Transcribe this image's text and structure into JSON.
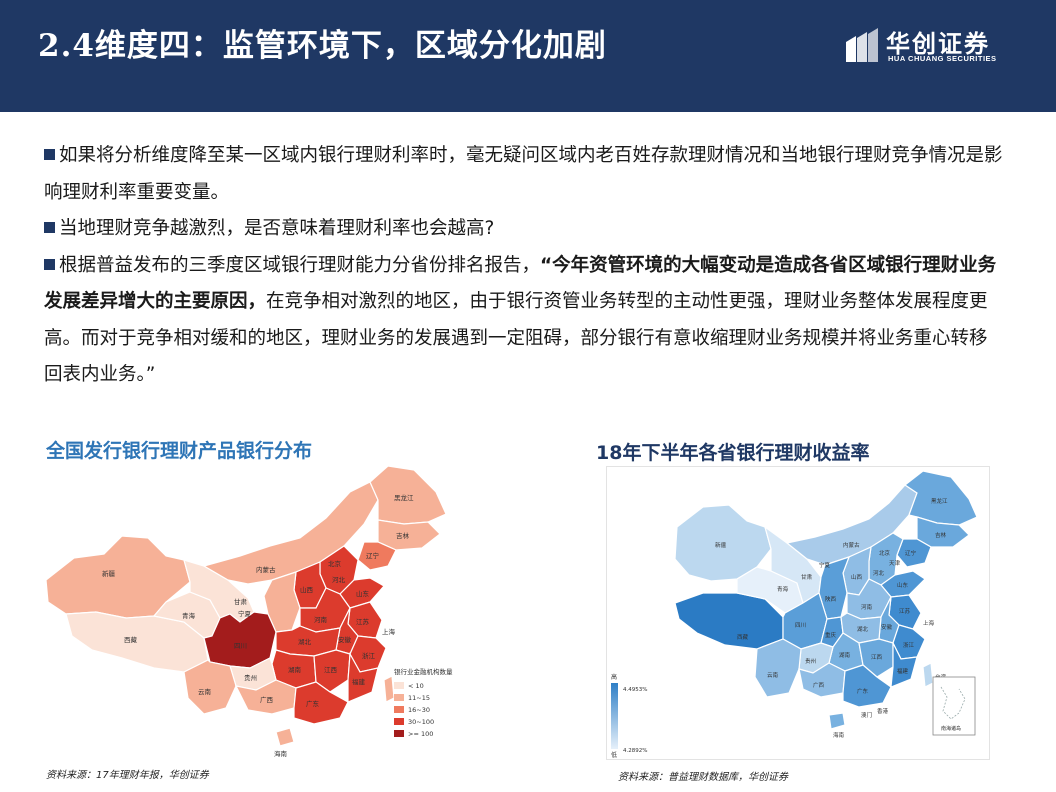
{
  "header": {
    "title": "2.4维度四：监管环境下，区域分化加剧",
    "logo_cn": "华创证券",
    "logo_en": "HUA CHUANG SECURITIES"
  },
  "paragraphs": {
    "p1": "如果将分析维度降至某一区域内银行理财利率时，毫无疑问区域内老百姓存款理财情况和当地银行理财竞争情况是影响理财利率重要变量。",
    "p2": "当地理财竞争越激烈，是否意味着理财利率也会越高?",
    "p3_pre": "根据普益发布的三季度区域银行理财能力分省份排名报告，",
    "p3_bold": "“今年资管环境的大幅变动是造成各省区域银行理财业务发展差异增大的主要原因，",
    "p3_post": "在竞争相对激烈的地区，由于银行资管业务转型的主动性更强，理财业务整体发展程度更高。而对于竞争相对缓和的地区，理财业务的发展遇到一定阻碍，部分银行有意收缩理财业务规模并将业务重心转移回表内业务。”"
  },
  "left_figure": {
    "caption": "全国发行银行理财产品银行分布",
    "legend_title": "银行业金融机构数量",
    "legend": [
      {
        "label": "< 10",
        "color": "#fbe3d7"
      },
      {
        "label": "11~15",
        "color": "#f6b197"
      },
      {
        "label": "16~30",
        "color": "#ef7a5e"
      },
      {
        "label": "30~100",
        "color": "#dc3b2d"
      },
      {
        "label": ">= 100",
        "color": "#a31c1c"
      }
    ],
    "labels": {
      "xinjiang": "新疆",
      "xizang": "西藏",
      "qinghai": "青海",
      "gansu": "甘肃",
      "neimenggu": "内蒙古",
      "heilongjiang": "黑龙江",
      "jilin": "吉林",
      "liaoning": "辽宁",
      "beijing": "北京",
      "hebei": "河北",
      "shanxi": "山西",
      "shandong": "山东",
      "henan": "河南",
      "sichuan": "四川",
      "yunnan": "云南",
      "guangxi": "广西",
      "guangdong": "广东",
      "hunan": "湖南",
      "hubei": "湖北",
      "jiangxi": "江西",
      "fujian": "福建",
      "zhejiang": "浙江",
      "shanghai": "上海",
      "hainan": "海南",
      "guizhou": "贵州",
      "ningxia": "宁夏",
      "anhui": "安徽",
      "jiangsu": "江苏"
    },
    "source": "资料来源：17年理财年报，华创证券"
  },
  "right_figure": {
    "caption": "18年下半年各省银行理财收益率",
    "scale_high_label": "高",
    "scale_low_label": "低",
    "scale_max": "4.4953%",
    "scale_min": "4.2892%",
    "inset_label": "南海诸岛",
    "labels": {
      "xinjiang": "新疆",
      "xizang": "西藏",
      "qinghai": "青海",
      "gansu": "甘肃",
      "neimenggu": "内蒙古",
      "heilongjiang": "黑龙江",
      "jilin": "吉林",
      "liaoning": "辽宁",
      "beijing": "北京",
      "tianjin": "天津",
      "hebei": "河北",
      "shanxi": "山西",
      "shandong": "山东",
      "henan": "河南",
      "shaanxi": "陕西",
      "ningxia": "宁夏",
      "sichuan": "四川",
      "chongqing": "重庆",
      "guizhou": "贵州",
      "yunnan": "云南",
      "guangxi": "广西",
      "guangdong": "广东",
      "hunan": "湖南",
      "hubei": "湖北",
      "jiangxi": "江西",
      "anhui": "安徽",
      "jiangsu": "江苏",
      "shanghai": "上海",
      "zhejiang": "浙江",
      "fujian": "福建",
      "taiwan": "台湾",
      "hainan": "海南",
      "hongkong": "香港",
      "macau": "澳门"
    },
    "source": "资料来源：普益理财数据库，华创证券"
  }
}
